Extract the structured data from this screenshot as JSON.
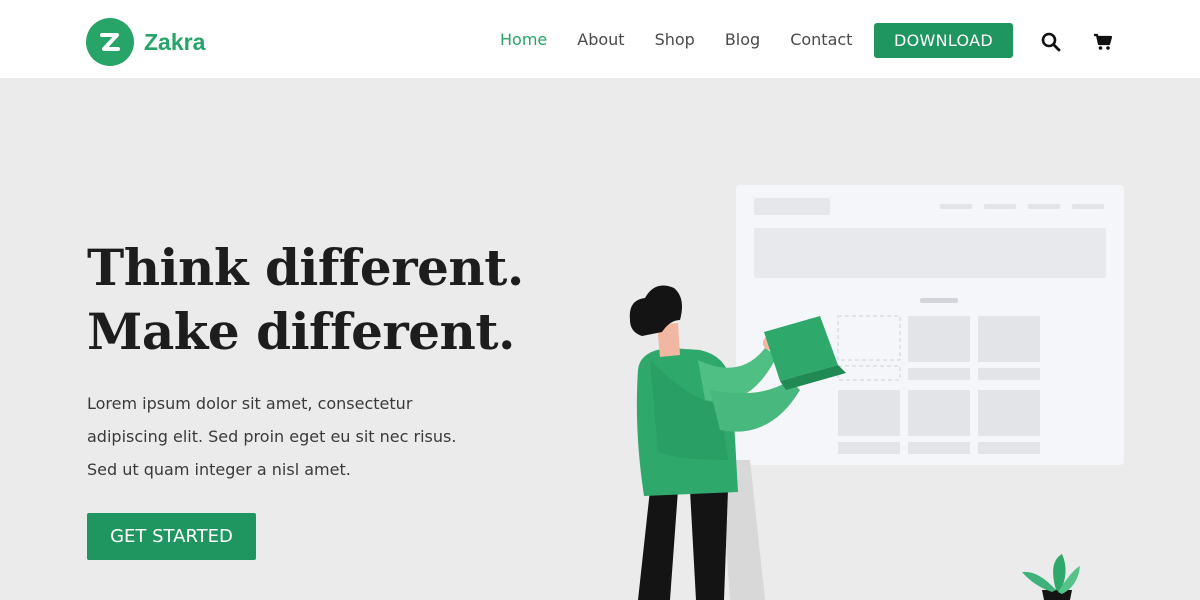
{
  "brand": {
    "name": "Zakra",
    "logo_letter": "Z",
    "accent_color": "#27a467"
  },
  "nav": {
    "items": [
      {
        "label": "Home",
        "active": true
      },
      {
        "label": "About",
        "active": false
      },
      {
        "label": "Shop",
        "active": false
      },
      {
        "label": "Blog",
        "active": false
      },
      {
        "label": "Contact",
        "active": false
      }
    ],
    "download_label": "DOWNLOAD",
    "icons": [
      "search-icon",
      "cart-icon"
    ]
  },
  "hero": {
    "title_line1": "Think different.",
    "title_line2": "Make different.",
    "text_line1": "Lorem ipsum dolor sit amet, consectetur",
    "text_line2": "adipiscing elit. Sed proin eget eu sit nec risus.",
    "text_line3": "Sed ut quam integer a nisl amet.",
    "cta_label": "GET STARTED"
  }
}
